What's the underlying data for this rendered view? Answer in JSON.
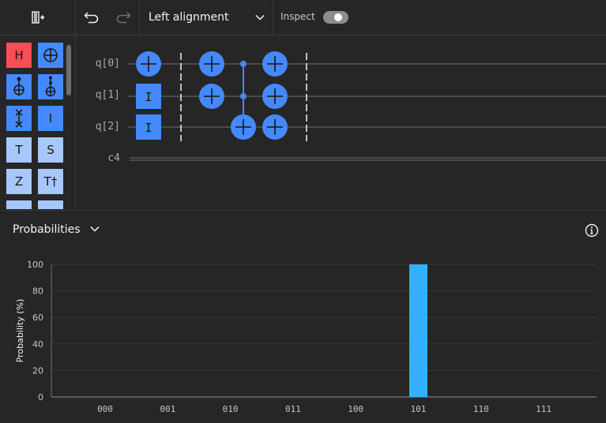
{
  "toolbar": {
    "alignment_label": "Left alignment",
    "inspect_label": "Inspect",
    "inspect_on": false
  },
  "palette": {
    "gates": [
      {
        "label": "H",
        "name": "gate-h",
        "color": "#fa4d56"
      },
      {
        "label": "",
        "name": "gate-x",
        "icon": "oplus-icon",
        "color": "#4589ff"
      },
      {
        "label": "",
        "name": "gate-cnot",
        "icon": "cnot-icon",
        "color": "#4589ff"
      },
      {
        "label": "",
        "name": "gate-toffoli",
        "icon": "toffoli-icon",
        "color": "#4589ff"
      },
      {
        "label": "",
        "name": "gate-swap",
        "icon": "swap-icon",
        "color": "#4589ff"
      },
      {
        "label": "I",
        "name": "gate-i",
        "color": "#4589ff"
      },
      {
        "label": "T",
        "name": "gate-t",
        "color": "#a6c8ff"
      },
      {
        "label": "S",
        "name": "gate-s",
        "color": "#a6c8ff"
      },
      {
        "label": "Z",
        "name": "gate-z",
        "color": "#a6c8ff"
      },
      {
        "label": "T†",
        "name": "gate-tdg",
        "color": "#a6c8ff"
      }
    ]
  },
  "circuit": {
    "qubits": [
      "q[0]",
      "q[1]",
      "q[2]"
    ],
    "classical": "c4",
    "gate_color": "#4589ff"
  },
  "probabilities": {
    "title": "Probabilities",
    "chart_data": {
      "type": "bar",
      "categories": [
        "000",
        "001",
        "010",
        "011",
        "100",
        "101",
        "110",
        "111"
      ],
      "values": [
        0,
        0,
        0,
        0,
        0,
        100,
        0,
        0
      ],
      "ylabel": "Probability (%)",
      "xlabel": "",
      "ylim": [
        0,
        100
      ],
      "yticks": [
        0,
        20,
        40,
        60,
        80,
        100
      ],
      "bar_color": "#33b1ff",
      "grid": true
    }
  }
}
